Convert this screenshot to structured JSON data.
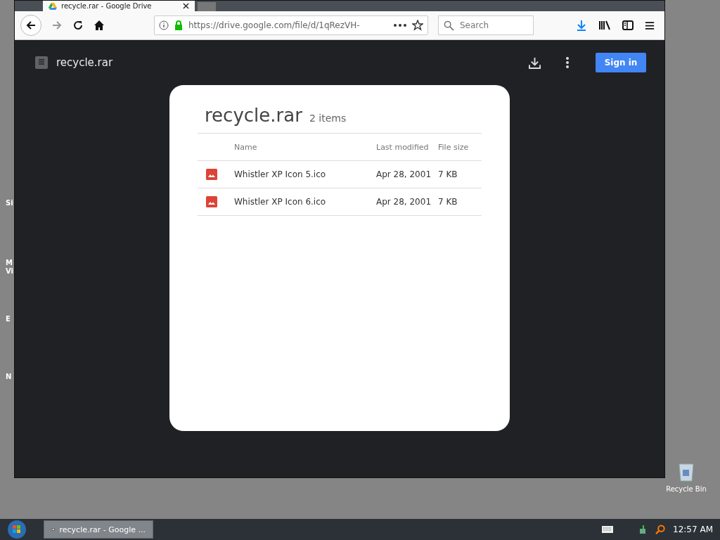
{
  "browser": {
    "tab": {
      "title": "recycle.rar - Google Drive",
      "selected": true
    },
    "address_bar": {
      "url": "https://drive.google.com/file/d/1qRezVH-"
    },
    "search": {
      "placeholder": "Search"
    }
  },
  "drive_header": {
    "file_name": "recycle.rar",
    "sign_in": "Sign in"
  },
  "archive": {
    "title": "recycle.rar",
    "count": "2 items",
    "columns": [
      "Name",
      "Last modified",
      "File size"
    ],
    "rows": [
      {
        "name": "Whistler XP Icon 5.ico",
        "modified": "Apr 28, 2001",
        "size": "7 KB"
      },
      {
        "name": "Whistler XP Icon 6.ico",
        "modified": "Apr 28, 2001",
        "size": "7 KB"
      }
    ]
  },
  "desktop": {
    "left_labels": [
      "Si",
      "M",
      "Vi",
      "E",
      "N"
    ],
    "recycle_bin": "Recycle Bin"
  },
  "taskbar": {
    "task": {
      "label": "recycle.rar - Google ...",
      "selected": true
    },
    "clock": "12:57 AM"
  }
}
